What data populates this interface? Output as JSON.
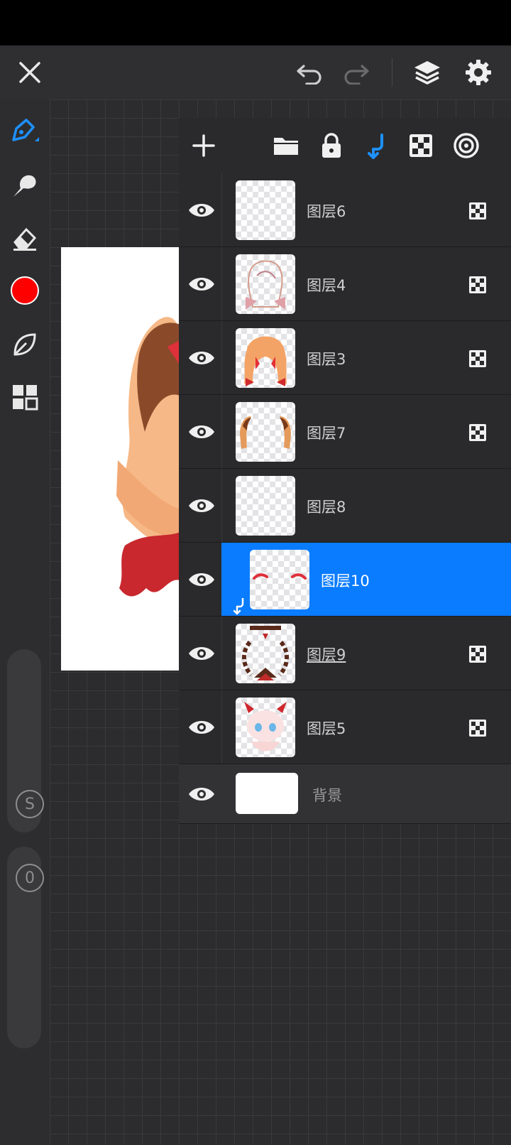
{
  "colors": {
    "accent": "#0a7cff",
    "brush_color": "#ff0000"
  },
  "top_bar": {
    "icons": [
      "close-icon",
      "undo-icon",
      "redo-icon",
      "layers-icon",
      "settings-icon"
    ]
  },
  "left_toolbar": {
    "tools": [
      "pen-icon",
      "smudge-icon",
      "eraser-icon",
      "color-swatch",
      "leaf-icon",
      "grid-icon"
    ],
    "size_label": "S",
    "opacity_label": "0"
  },
  "layers_panel": {
    "toolbar_icons": [
      "add-icon",
      "folder-icon",
      "lock-icon",
      "clip-icon",
      "alpha-lock-icon",
      "layer-mode-icon"
    ],
    "layers": [
      {
        "name": "图层6",
        "selected": false,
        "alpha_lock": true
      },
      {
        "name": "图层4",
        "selected": false,
        "alpha_lock": true
      },
      {
        "name": "图层3",
        "selected": false,
        "alpha_lock": true
      },
      {
        "name": "图层7",
        "selected": false,
        "alpha_lock": true
      },
      {
        "name": "图层8",
        "selected": false,
        "alpha_lock": false
      },
      {
        "name": "图层10",
        "selected": true,
        "alpha_lock": false,
        "clipped": true
      },
      {
        "name": "图层9",
        "selected": false,
        "alpha_lock": true
      },
      {
        "name": "图层5",
        "selected": false,
        "alpha_lock": true
      }
    ],
    "background_layer": {
      "name": "背景"
    }
  }
}
